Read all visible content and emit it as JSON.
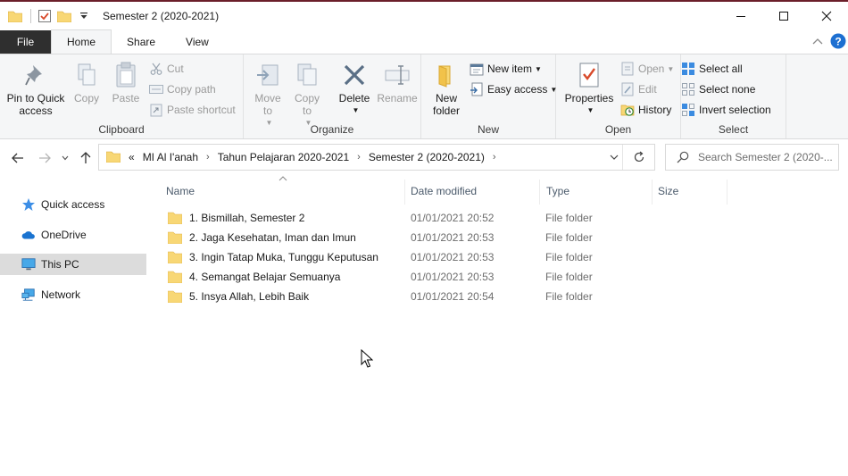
{
  "window": {
    "title": "Semester 2 (2020-2021)"
  },
  "tabs": {
    "file": "File",
    "home": "Home",
    "share": "Share",
    "view": "View"
  },
  "ribbon": {
    "clipboard": {
      "label": "Clipboard",
      "pin": "Pin to Quick access",
      "copy": "Copy",
      "paste": "Paste",
      "cut": "Cut",
      "copy_path": "Copy path",
      "paste_shortcut": "Paste shortcut"
    },
    "organize": {
      "label": "Organize",
      "move_to": "Move to",
      "copy_to": "Copy to",
      "delete": "Delete",
      "rename": "Rename"
    },
    "new": {
      "label": "New",
      "new_folder": "New folder",
      "new_item": "New item",
      "easy_access": "Easy access"
    },
    "open": {
      "label": "Open",
      "properties": "Properties",
      "open": "Open",
      "edit": "Edit",
      "history": "History"
    },
    "select": {
      "label": "Select",
      "select_all": "Select all",
      "select_none": "Select none",
      "invert_selection": "Invert selection"
    }
  },
  "address": {
    "overflow": "«",
    "crumbs": [
      "MI Al I'anah",
      "Tahun Pelajaran 2020-2021",
      "Semester 2 (2020-2021)"
    ]
  },
  "search": {
    "placeholder": "Search Semester 2 (2020-..."
  },
  "navpane": {
    "items": [
      {
        "label": "Quick access",
        "icon": "star-icon"
      },
      {
        "label": "OneDrive",
        "icon": "cloud-icon"
      },
      {
        "label": "This PC",
        "icon": "monitor-icon"
      },
      {
        "label": "Network",
        "icon": "network-icon"
      }
    ]
  },
  "columns": {
    "name": "Name",
    "date": "Date modified",
    "type": "Type",
    "size": "Size"
  },
  "files": [
    {
      "name": "1. Bismillah, Semester 2",
      "date": "01/01/2021 20:52",
      "type": "File folder"
    },
    {
      "name": "2. Jaga Kesehatan, Iman dan Imun",
      "date": "01/01/2021 20:53",
      "type": "File folder"
    },
    {
      "name": "3. Ingin Tatap Muka, Tunggu Keputusan",
      "date": "01/01/2021 20:53",
      "type": "File folder"
    },
    {
      "name": "4. Semangat Belajar Semuanya",
      "date": "01/01/2021 20:53",
      "type": "File folder"
    },
    {
      "name": "5. Insya Allah, Lebih Baik",
      "date": "01/01/2021 20:54",
      "type": "File folder"
    }
  ],
  "colors": {
    "folder": "#f8d775",
    "accent": "#0078d7",
    "file_tab": "#2f2f2f",
    "selected": "#dcdcdc"
  }
}
